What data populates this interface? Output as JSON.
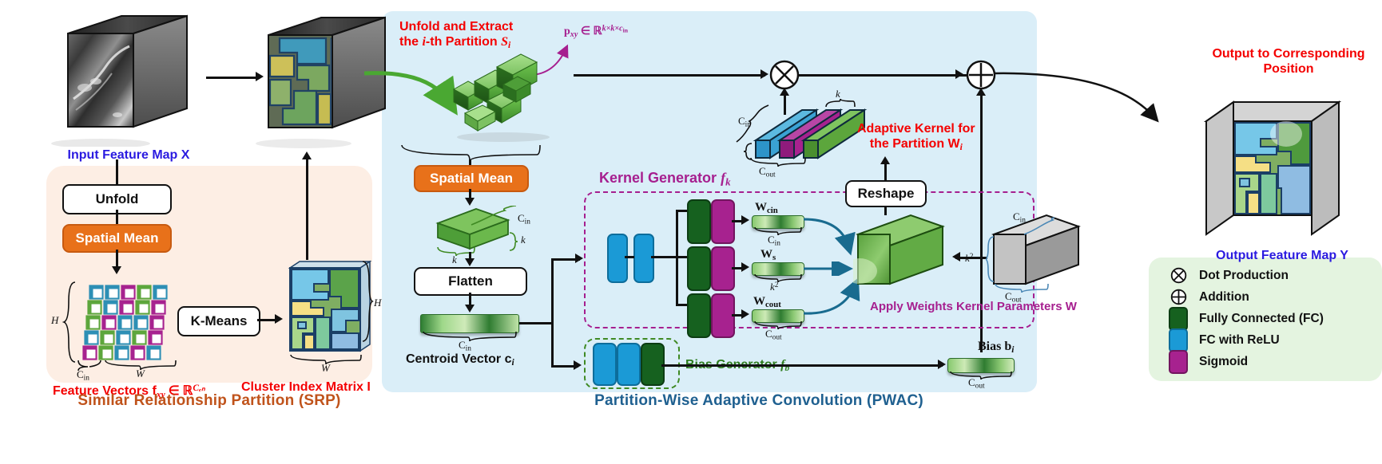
{
  "sections": {
    "srp": {
      "title": "Similar Relationship Partition (SRP)"
    },
    "pwac": {
      "title": "Partition-Wise Adaptive Convolution (PWAC)"
    }
  },
  "left": {
    "input_label": "Input Feature Map X",
    "unfold_label": "Unfold",
    "spatial_mean_label": "Spatial Mean",
    "kmeans_label": "K-Means",
    "feature_vectors_label": "Feature Vectors f",
    "feature_vectors_sub": "xy",
    "feature_vectors_tail": " ∈ ℝ",
    "feature_vectors_sup": "Cₑₙ",
    "cluster_index_label": "Cluster Index Matrix I",
    "dim_H": "H",
    "dim_W": "W",
    "dim_Cin": "C",
    "dim_Cin_sub": "in"
  },
  "middle": {
    "unfold_extract_line1": "Unfold and Extract",
    "unfold_extract_line2_a": "the ",
    "unfold_extract_line2_i": "i",
    "unfold_extract_line2_b": "-th Partition ",
    "unfold_extract_line2_S": "S",
    "unfold_extract_line2_sub": "i",
    "pxy_p": "p",
    "pxy_sub": "xy",
    "pxy_mid": " ∈ ℝ",
    "pxy_sup": "k×k×c",
    "pxy_sup2": "in",
    "spatial_mean_label": "Spatial Mean",
    "flatten_label": "Flatten",
    "centroid_label_a": "Centroid Vector c",
    "centroid_label_sub": "i",
    "dim_k": "k",
    "dim_Cin": "C",
    "dim_Cin_sub": "in"
  },
  "kernel_generator": {
    "title_a": "Kernel Generator ",
    "title_f": "f",
    "title_sub": "k",
    "w_cin": "W",
    "w_cin_sub": "cin",
    "w_s": "W",
    "w_s_sub": "s",
    "w_cout": "W",
    "w_cout_sub": "cout",
    "dim_cin": "C",
    "dim_cin_sub": "in",
    "dim_k2": "k",
    "dim_k2_sup": "2",
    "dim_cout": "C",
    "dim_cout_sub": "out",
    "reshape_label": "Reshape",
    "apply_weights_label": "Apply Weights",
    "kernel_params_label_a": "Kernel Parameters W"
  },
  "bias_generator": {
    "title_a": "Bias Generator ",
    "title_f": "f",
    "title_sub": "b",
    "bias_label_a": "Bias b",
    "bias_label_sub": "i",
    "dim_cout": "C",
    "dim_cout_sub": "out"
  },
  "adaptive_kernel": {
    "line1": "Adaptive Kernel for",
    "line2_a": "the Partition W",
    "line2_sub": "i",
    "dim_cin": "C",
    "dim_cin_sub": "in",
    "dim_k": "k",
    "dim_cout": "C",
    "dim_cout_sub": "out"
  },
  "right": {
    "output_corresponding_line1": "Output to Corresponding",
    "output_corresponding_line2": "Position",
    "output_label": "Output Feature Map Y"
  },
  "legend": {
    "items": [
      {
        "symbol": "dot-production-icon",
        "label": "Dot Production",
        "color": "#ffffff"
      },
      {
        "symbol": "addition-icon",
        "label": "Addition",
        "color": "#ffffff"
      },
      {
        "symbol": "chip",
        "label": "Fully Connected (FC)",
        "color": "#16611f"
      },
      {
        "symbol": "chip",
        "label": "FC with ReLU",
        "color": "#1b9ad6"
      },
      {
        "symbol": "chip",
        "label": "Sigmoid",
        "color": "#a7228f"
      }
    ]
  },
  "colors": {
    "srp_panel": "#fdeee4",
    "pwac_panel": "#daeef8",
    "legend_panel": "#e4f4e0",
    "srp_title": "#c0531b",
    "pwac_title": "#1f6090",
    "red_annotation": "#f40000",
    "blue_annotation": "#2a1ae0",
    "magenta_annotation": "#a61f8f",
    "green_annotation": "#2e7d1f",
    "orange_box": "#e8711a",
    "fc_green": "#16611f",
    "fc_blue": "#1b9ad6",
    "sigmoid_magenta": "#a7228f"
  }
}
